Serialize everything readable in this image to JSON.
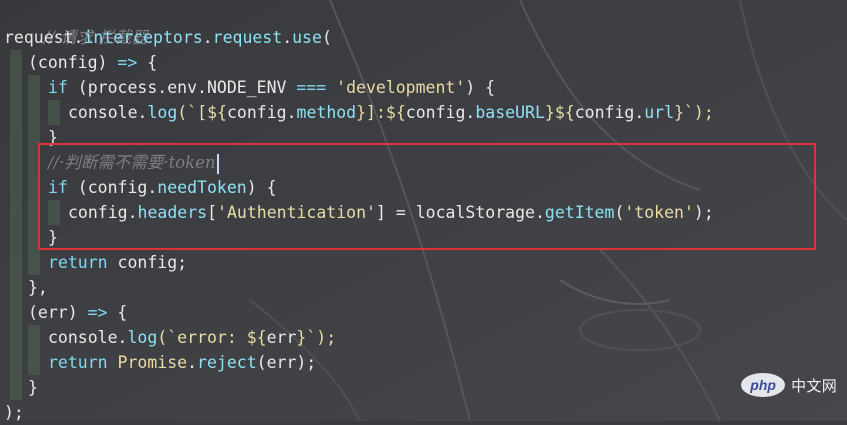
{
  "code": {
    "l1_comment": "//·请求·拦截器",
    "l2": [
      "request",
      ".",
      "interceptors",
      ".",
      "request",
      ".",
      "use",
      "("
    ],
    "l3": [
      "(config)",
      " => ",
      "{"
    ],
    "l4": [
      "if",
      " (",
      "process",
      ".",
      "env",
      ".",
      "NODE_ENV",
      " === ",
      "'development'",
      ") {"
    ],
    "l5": [
      "console",
      ".",
      "log",
      "(`[${",
      "config",
      ".",
      "method",
      "}]:${",
      "config",
      ".",
      "baseURL",
      "}${",
      "config",
      ".",
      "url",
      "}`);"
    ],
    "l6": "}",
    "l7_comment": "//·判断需不需要·token",
    "l8": [
      "if",
      " (",
      "config",
      ".",
      "needToken",
      ") {"
    ],
    "l9": [
      "config",
      ".",
      "headers",
      "[",
      "'Authentication'",
      "] = ",
      "localStorage",
      ".",
      "getItem",
      "(",
      "'token'",
      ");"
    ],
    "l10": "}",
    "l11": [
      "return",
      " config;"
    ],
    "l12": "},",
    "l13": [
      "(err)",
      " => ",
      "{"
    ],
    "l14": [
      "console",
      ".",
      "log",
      "(`error: ${",
      "err",
      "}`);"
    ],
    "l15": [
      "return",
      " Promise",
      ".",
      "reject",
      "(err);"
    ],
    "l16": "}",
    "l17": ");"
  },
  "watermark": {
    "logo": "php",
    "text": "中文网"
  },
  "colors": {
    "keyword": "#7fd9f0",
    "string": "#e9dca4",
    "comment": "#7e7f86",
    "highlight_border": "#e0313a"
  }
}
